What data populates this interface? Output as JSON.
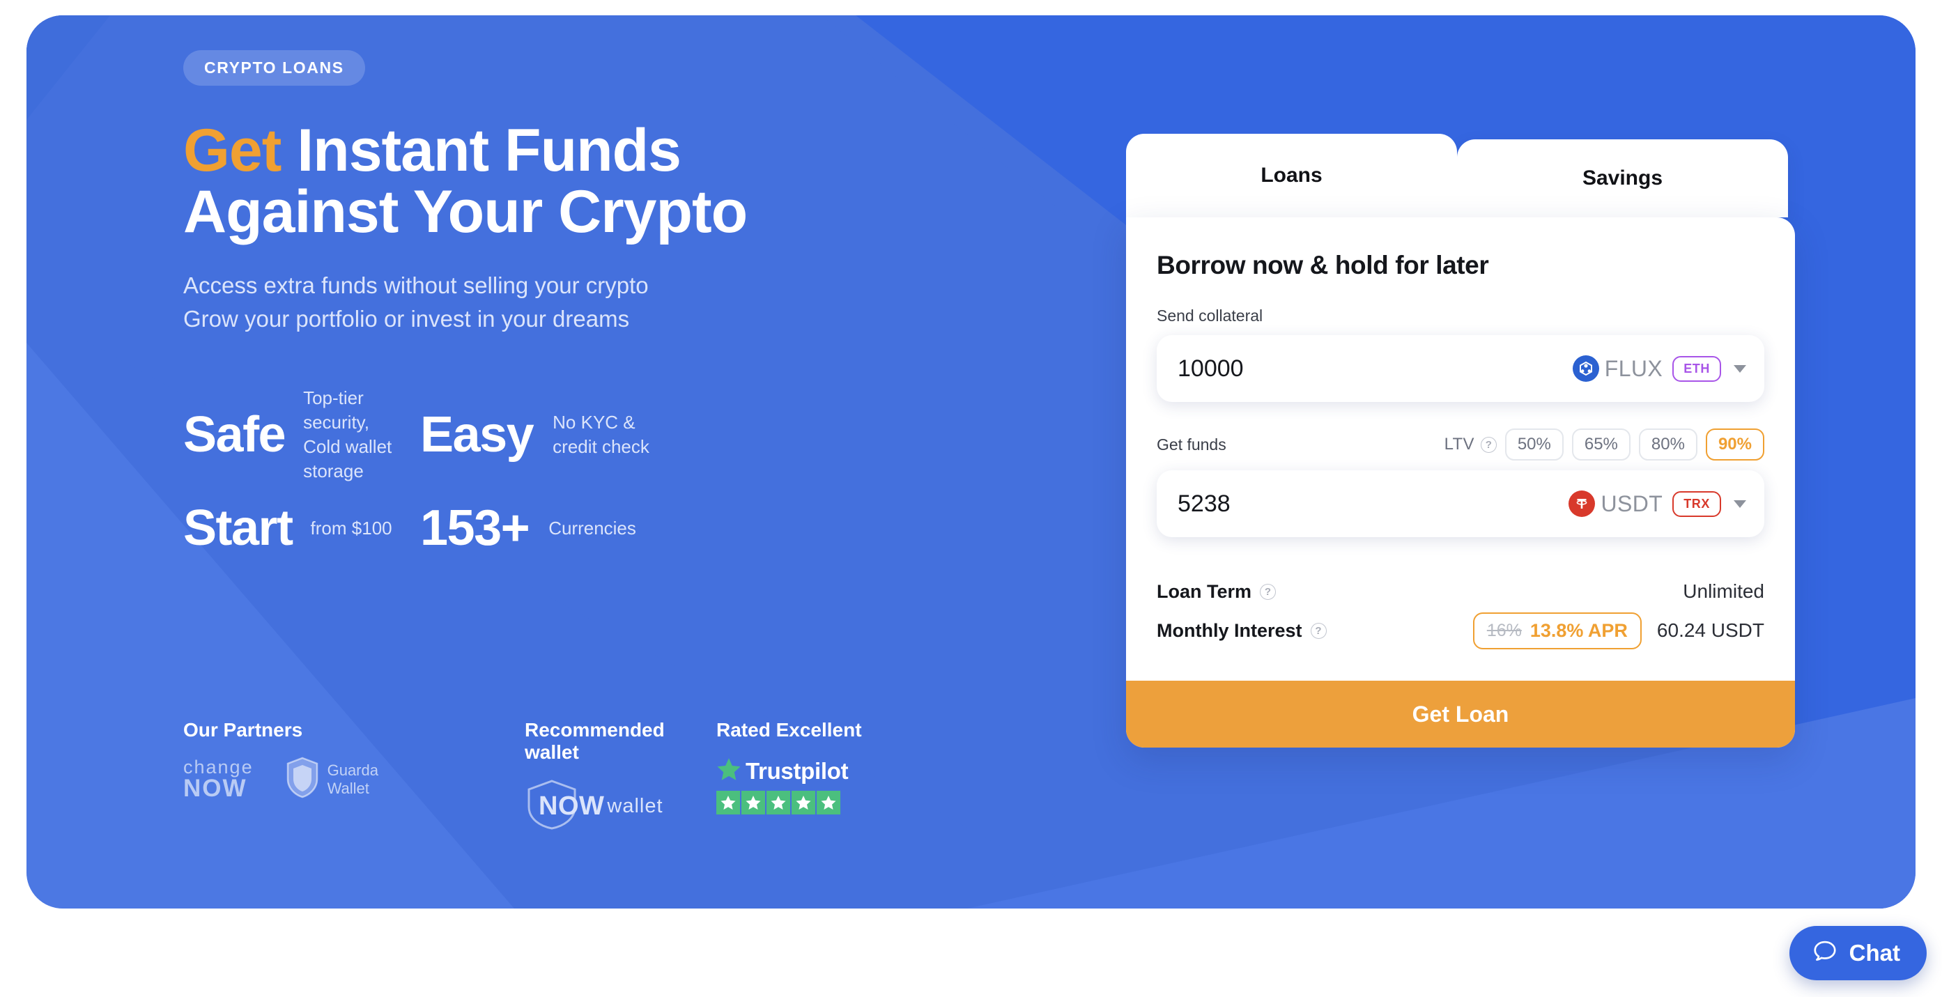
{
  "hero": {
    "eyebrow": "CRYPTO LOANS",
    "headline_accent": "Get",
    "headline_rest": " Instant Funds",
    "headline_line2": "Against Your Crypto",
    "subtitle_line1": "Access extra funds without selling your crypto",
    "subtitle_line2": "Grow your portfolio or invest in your dreams",
    "accent_color": "#f0a032",
    "bg_color": "#4470dd"
  },
  "stats": [
    {
      "num": "Safe",
      "desc": "Top-tier security,\nCold wallet storage"
    },
    {
      "num": "Easy",
      "desc": "No KYC &\ncredit check"
    },
    {
      "num": "Start",
      "desc": "from $100"
    },
    {
      "num": "153+",
      "desc": "Currencies"
    }
  ],
  "trust": {
    "partners_title": "Our Partners",
    "partner_changenow_l1": "change",
    "partner_changenow_l2": "NOW",
    "partner_guarda_l1": "Guarda",
    "partner_guarda_l2": "Wallet",
    "wallet_title": "Recommended wallet",
    "wallet_now": "NOW",
    "wallet_suffix": "wallet",
    "rating_title": "Rated Excellent",
    "trustpilot_name": "Trustpilot",
    "trustpilot_stars": 5,
    "trustpilot_green": "#4bbf7e"
  },
  "widget": {
    "tabs": [
      {
        "label": "Loans",
        "active": true
      },
      {
        "label": "Savings",
        "active": false
      }
    ],
    "panel_title": "Borrow now & hold for later",
    "collateral": {
      "label": "Send collateral",
      "value": "10000",
      "coin": "FLUX",
      "network": "ETH",
      "coin_color": "#2b61d1",
      "network_color": "#a855e8"
    },
    "funds": {
      "label": "Get funds",
      "value": "5238",
      "coin": "USDT",
      "network": "TRX",
      "coin_color": "#d8392b",
      "network_color": "#d8392b"
    },
    "ltv": {
      "label": "LTV",
      "help": "?",
      "options": [
        "50%",
        "65%",
        "80%",
        "90%"
      ],
      "selected": "90%"
    },
    "terms": [
      {
        "label": "Loan Term",
        "help": "?",
        "value": "Unlimited"
      }
    ],
    "interest": {
      "label": "Monthly Interest",
      "help": "?",
      "old_rate": "16%",
      "new_rate": "13.8% APR",
      "amount": "60.24 USDT"
    },
    "cta_label": "Get Loan",
    "cta_color": "#eda03c"
  },
  "chat": {
    "label": "Chat",
    "icon": "chat-bubble-icon",
    "color": "#3566e0"
  }
}
